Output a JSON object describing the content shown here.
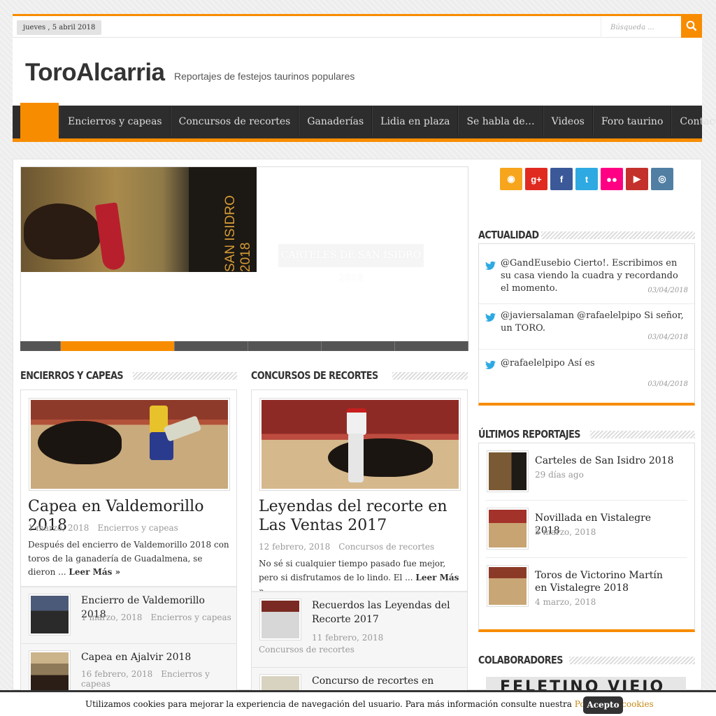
{
  "topbar": {
    "date": "jueves , 5 abril 2018",
    "search_placeholder": "Búsqueda ..."
  },
  "header": {
    "site_title": "ToroAlcarria",
    "tagline": "Reportajes de festejos taurinos populares"
  },
  "nav": {
    "items": [
      {
        "label": "Encierros y capeas"
      },
      {
        "label": "Concursos de recortes"
      },
      {
        "label": "Ganaderías"
      },
      {
        "label": "Lidia en plaza"
      },
      {
        "label": "Se habla de…"
      },
      {
        "label": "Videos"
      },
      {
        "label": "Foro taurino"
      },
      {
        "label": "Contactar"
      }
    ]
  },
  "slider": {
    "poster_title": "SAN ISIDRO 2018",
    "caption": "CARTELES DE SAN ISIDRO 2018",
    "active_slide": 2,
    "slide_count": 6
  },
  "sections": {
    "encierros": {
      "title": "ENCIERROS Y CAPEAS",
      "featured": {
        "title": "Capea en Valdemorillo 2018",
        "date": "1 marzo, 2018",
        "category": "Encierros y capeas",
        "excerpt": "Después del encierro de Valdemorillo 2018 con toros de la ganadería de Guadalmena, se dieron ...",
        "read_more": "Leer Más »"
      },
      "list": [
        {
          "title": "Encierro de Valdemorillo 2018",
          "date": "1 marzo, 2018",
          "category": "Encierros y capeas"
        },
        {
          "title": "Capea en Ajalvir 2018",
          "date": "16 febrero, 2018",
          "category": "Encierros y capeas"
        }
      ]
    },
    "concursos": {
      "title": "CONCURSOS DE RECORTES",
      "featured": {
        "title": "Leyendas del recorte en Las Ventas 2017",
        "date": "12 febrero, 2018",
        "category": "Concursos de recortes",
        "excerpt": "No sé si cualquier tiempo pasado fue mejor, pero si disfrutamos de lo lindo. El ...",
        "read_more": "Leer Más »"
      },
      "list": [
        {
          "title": "Recuerdos las Leyendas del Recorte 2017",
          "date": "11 febrero, 2018",
          "category": "Concursos de recortes"
        },
        {
          "title": "Concurso de recortes en",
          "date": "",
          "category": ""
        }
      ]
    }
  },
  "sidebar": {
    "social": [
      {
        "name": "rss-icon",
        "glyph": "◉",
        "color": "#f7a51c"
      },
      {
        "name": "google-plus-icon",
        "glyph": "g+",
        "color": "#e02a20"
      },
      {
        "name": "facebook-icon",
        "glyph": "f",
        "color": "#3b5998"
      },
      {
        "name": "twitter-icon",
        "glyph": "t",
        "color": "#2ea9e2"
      },
      {
        "name": "flickr-icon",
        "glyph": "●●",
        "color": "#ff0084"
      },
      {
        "name": "youtube-icon",
        "glyph": "▶",
        "color": "#c4302b"
      },
      {
        "name": "instagram-icon",
        "glyph": "◎",
        "color": "#517fa4"
      }
    ],
    "actualidad": {
      "title": "ACTUALIDAD",
      "tweets": [
        {
          "text": "@GandEusebio Cierto!. Escribimos en su casa viendo la cuadra y recordando el momento.",
          "date": "03/04/2018"
        },
        {
          "text": "@javiersalaman @rafaelelpipo Si señor, un TORO.",
          "date": "03/04/2018"
        },
        {
          "text": "@rafaelelpipo Así es",
          "date": "03/04/2018"
        }
      ]
    },
    "ultimos": {
      "title": "ÚLTIMOS REPORTAJES",
      "items": [
        {
          "title": "Carteles de San Isidro 2018",
          "meta": "29 días ago"
        },
        {
          "title": "Novillada en Vistalegre 2018",
          "meta": "5 marzo, 2018"
        },
        {
          "title": "Toros de Victorino Martín en Vistalegre 2018",
          "meta": "4 marzo, 2018"
        }
      ]
    },
    "colaboradores": {
      "title": "COLABORADORES",
      "banner": "FELETINO VIEJO"
    }
  },
  "cookie": {
    "text": "Utilizamos cookies para mejorar la experiencia de navegación del usuario. Para más información consulte nuestra",
    "link": "Política de cookies",
    "accept": "Acepto"
  },
  "colors": {
    "accent": "#f88c00",
    "nav_bg": "#2d2d2d"
  }
}
